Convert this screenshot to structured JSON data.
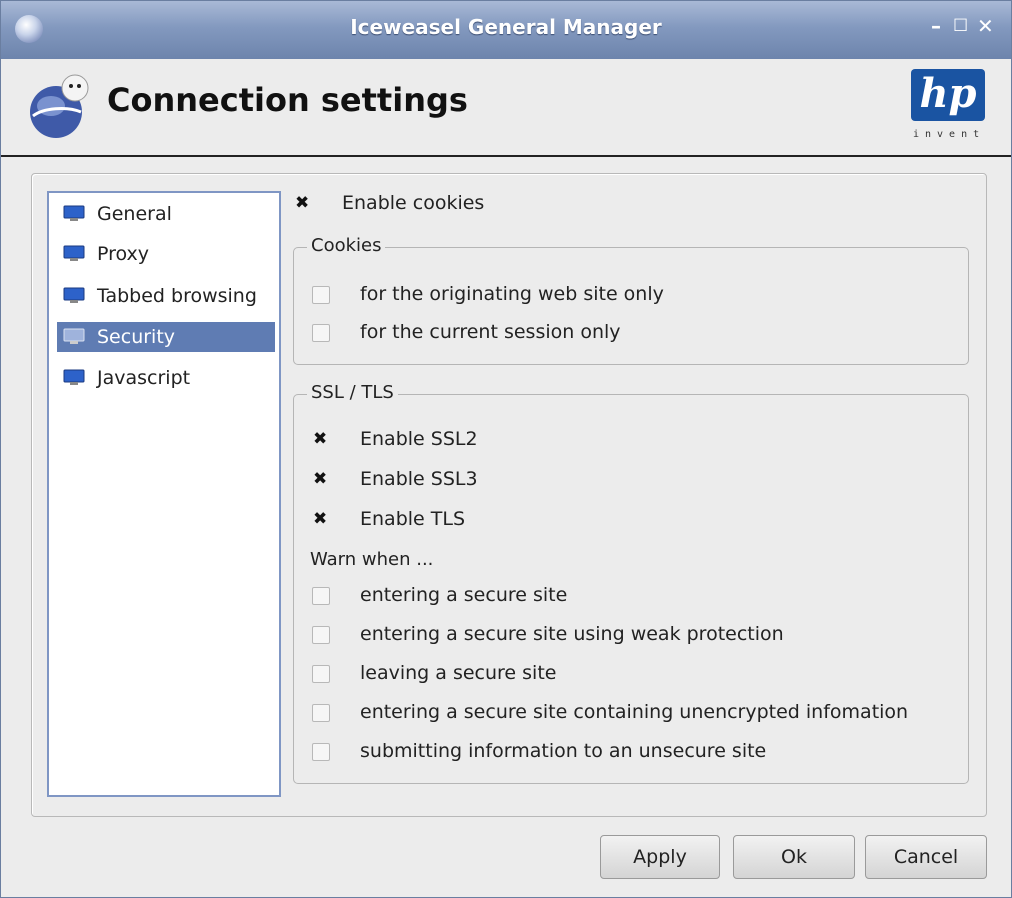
{
  "window": {
    "title": "Iceweasel General Manager",
    "controls": [
      "minimize",
      "maximize",
      "close"
    ]
  },
  "header": {
    "title": "Connection settings",
    "hp_letters": "hp",
    "hp_tagline": "invent"
  },
  "sidebar": {
    "items": [
      {
        "label": "General",
        "icon": "monitor-icon",
        "selected": false
      },
      {
        "label": "Proxy",
        "icon": "monitor-icon",
        "selected": false
      },
      {
        "label": "Tabbed browsing",
        "icon": "monitor-icon",
        "selected": false
      },
      {
        "label": "Security",
        "icon": "monitor-icon",
        "selected": true
      },
      {
        "label": "Javascript",
        "icon": "monitor-icon",
        "selected": false
      }
    ]
  },
  "main": {
    "enable_cookies": {
      "label": "Enable cookies",
      "checked": true
    },
    "cookies_group": {
      "legend": "Cookies",
      "options": [
        {
          "label": "for the originating web site only",
          "checked": false
        },
        {
          "label": "for the current session only",
          "checked": false
        }
      ]
    },
    "ssl_group": {
      "legend": "SSL / TLS",
      "options": [
        {
          "label": "Enable SSL2",
          "checked": true
        },
        {
          "label": "Enable SSL3",
          "checked": true
        },
        {
          "label": "Enable TLS",
          "checked": true
        }
      ],
      "warn_label": "Warn when ...",
      "warn_options": [
        {
          "label": "entering a secure site",
          "checked": false
        },
        {
          "label": "entering a secure site using weak protection",
          "checked": false
        },
        {
          "label": "leaving a secure site",
          "checked": false
        },
        {
          "label": "entering a secure site containing unencrypted infomation",
          "checked": false
        },
        {
          "label": "submitting information to an unsecure site",
          "checked": false
        }
      ]
    }
  },
  "buttons": {
    "apply": "Apply",
    "ok": "Ok",
    "cancel": "Cancel"
  },
  "colors": {
    "selection": "#5f7cb3",
    "titlebar": "#8399bf",
    "hp_blue": "#1a54a2"
  }
}
